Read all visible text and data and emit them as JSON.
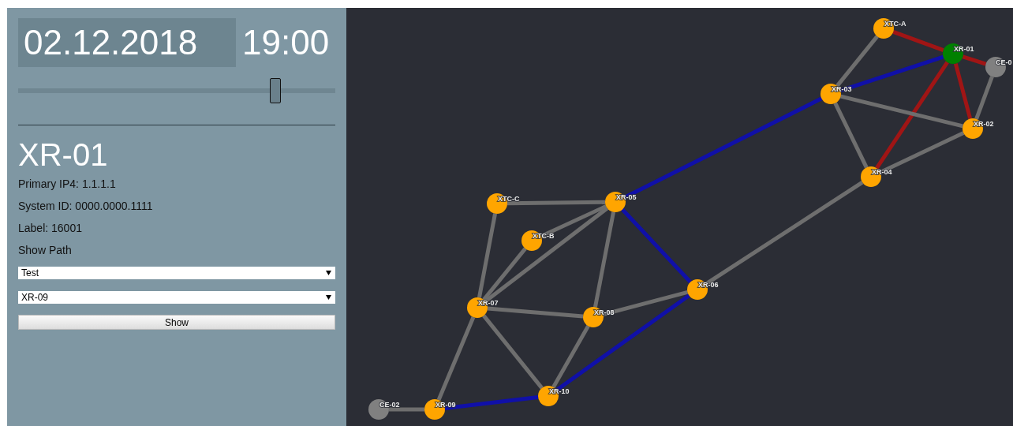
{
  "date": "02.12.2018",
  "time": "19:00",
  "timeline": {
    "level": 0.81
  },
  "router": {
    "name": "XR-01",
    "details": [
      "Primary IP4: 1.1.1.1",
      "System ID: 0000.0000.1111",
      "Label: 16001"
    ]
  },
  "show_path": {
    "title": "Show Path",
    "selects": [
      {
        "value": "Test"
      },
      {
        "value": "XR-09"
      }
    ],
    "button": "Show"
  },
  "topology": {
    "nodes": [
      {
        "label": "XTC-A",
        "color": "#ffa500"
      },
      {
        "label": "XR-01",
        "color": "#008000"
      },
      {
        "label": "CE-0",
        "color": "#808080"
      },
      {
        "label": "XR-03",
        "color": "#ffa500"
      },
      {
        "label": "XR-02",
        "color": "#ffa500"
      },
      {
        "label": "XR-04",
        "color": "#ffa500"
      },
      {
        "label": "XR-05",
        "color": "#ffa500"
      },
      {
        "label": "XTC-C",
        "color": "#ffa500"
      },
      {
        "label": "XTC-B",
        "color": "#ffa500"
      },
      {
        "label": "XR-06",
        "color": "#ffa500"
      },
      {
        "label": "XR-07",
        "color": "#ffa500"
      },
      {
        "label": "XR-08",
        "color": "#ffa500"
      },
      {
        "label": "XR-10",
        "color": "#ffa500"
      },
      {
        "label": "XR-09",
        "color": "#ffa500"
      },
      {
        "label": "CE-02",
        "color": "#808080"
      }
    ],
    "links": [
      {
        "color": "#a01515"
      },
      {
        "color": "#6e6e6e"
      },
      {
        "color": "#a01515"
      },
      {
        "color": "#1010a8"
      },
      {
        "color": "#a01515"
      },
      {
        "color": "#a01515"
      },
      {
        "color": "#6e6e6e"
      },
      {
        "color": "#6e6e6e"
      },
      {
        "color": "#6e6e6e"
      },
      {
        "color": "#6e6e6e"
      },
      {
        "color": "#6e6e6e"
      },
      {
        "color": "#1010a8"
      },
      {
        "color": "#6e6e6e"
      },
      {
        "color": "#6e6e6e"
      },
      {
        "color": "#6e6e6e"
      },
      {
        "color": "#6e6e6e"
      },
      {
        "color": "#6e6e6e"
      },
      {
        "color": "#6e6e6e"
      },
      {
        "color": "#1010a8"
      },
      {
        "color": "#6e6e6e"
      },
      {
        "color": "#6e6e6e"
      },
      {
        "color": "#6e6e6e"
      },
      {
        "color": "#6e6e6e"
      },
      {
        "color": "#6e6e6e"
      },
      {
        "color": "#1010a8"
      },
      {
        "color": "#1010a8"
      },
      {
        "color": "#6e6e6e"
      }
    ]
  }
}
